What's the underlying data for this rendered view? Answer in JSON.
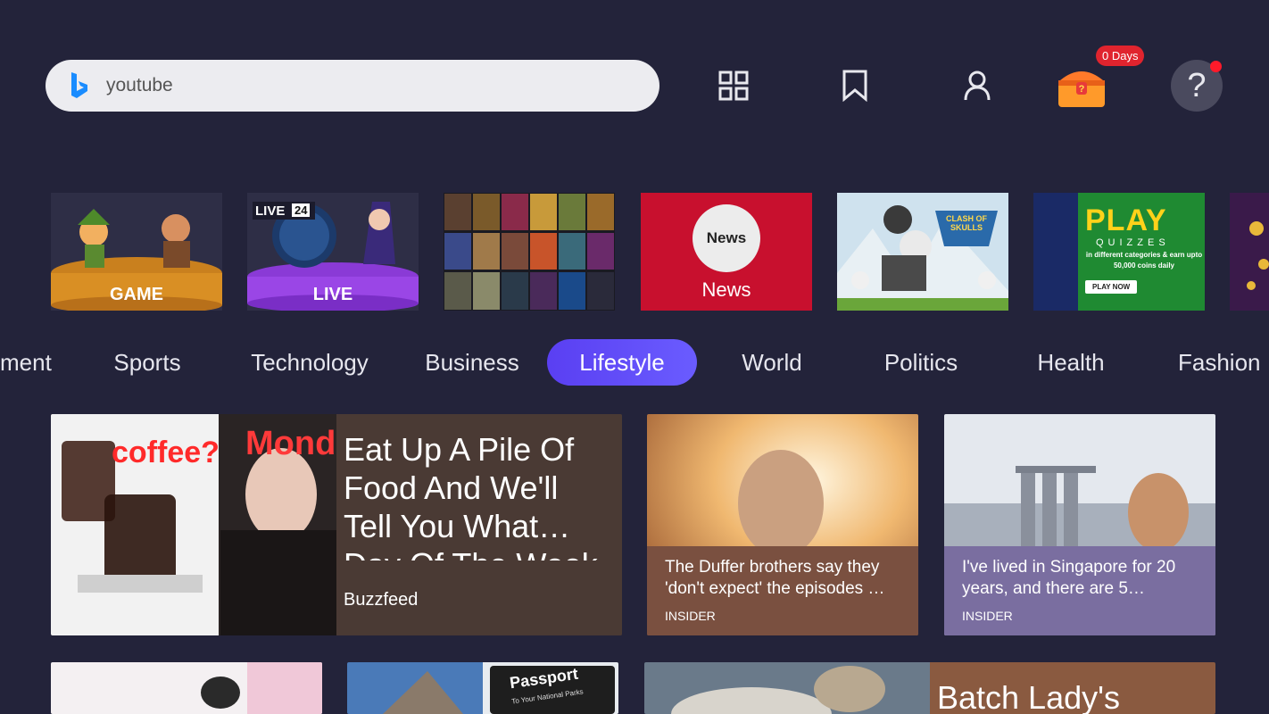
{
  "search": {
    "value": "youtube",
    "placeholder": ""
  },
  "header": {
    "streak_badge": "0 Days",
    "help_symbol": "?"
  },
  "icons": {
    "apps": "grid-icon",
    "bookmark": "bookmark-icon",
    "profile": "person-icon",
    "rewards": "treasure-chest-icon",
    "help": "question-icon"
  },
  "tiles": [
    {
      "label": "GAME"
    },
    {
      "label": "LIVE",
      "live_tag": "LIVE",
      "live_number": "24"
    },
    {
      "label": ""
    },
    {
      "label": "News",
      "logo_text": "News"
    },
    {
      "label": "",
      "logo_text": "CLASH OF SKULLS"
    },
    {
      "label": "",
      "headline": "PLAY",
      "sub": "QUIZZES",
      "desc": "in different categories & earn upto 50,000 coins daily",
      "cta": "PLAY NOW"
    }
  ],
  "categories": [
    "ment",
    "Sports",
    "Technology",
    "Business",
    "Lifestyle",
    "World",
    "Politics",
    "Health",
    "Fashion"
  ],
  "active_category": "Lifestyle",
  "cards": {
    "featured": {
      "title": "Eat Up A Pile Of Food And We'll Tell You What… Day Of The Week",
      "source": "Buzzfeed",
      "img_text_1": "coffee?",
      "img_text_2": "Monda"
    },
    "card2": {
      "title": "The Duffer brothers say they 'don't expect' the episodes …",
      "source": "INSIDER"
    },
    "card3": {
      "title": "I've lived in Singapore for 20 years, and there are 5…",
      "source": "INSIDER"
    },
    "bottom3": {
      "title": "Batch Lady's"
    },
    "bottom2": {
      "img_text": "Passport",
      "img_sub": "To Your National Parks"
    }
  },
  "colors": {
    "background": "#23233a",
    "accent": "#5a3ff2",
    "news_red": "#c8102e",
    "badge_red": "#e0242e"
  }
}
